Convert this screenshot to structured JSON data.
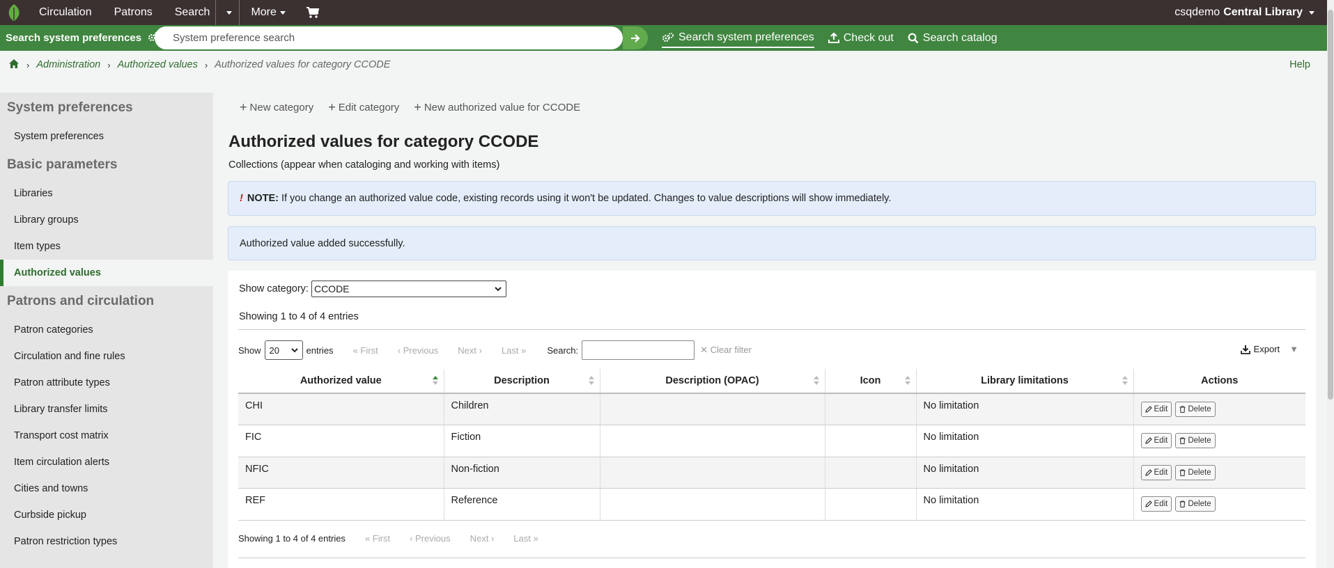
{
  "topnav": {
    "items": [
      "Circulation",
      "Patrons",
      "Search",
      "More"
    ],
    "user": "csqdemo",
    "library": "Central Library"
  },
  "searchbar": {
    "label": "Search system preferences",
    "placeholder": "System preference search",
    "links": [
      "Search system preferences",
      "Check out",
      "Search catalog"
    ]
  },
  "breadcrumb": {
    "home": "home-icon",
    "items": [
      "Administration",
      "Authorized values"
    ],
    "current": "Authorized values for category CCODE",
    "help": "Help"
  },
  "sidebar": {
    "sections": [
      {
        "title": "System preferences",
        "items": [
          "System preferences"
        ]
      },
      {
        "title": "Basic parameters",
        "items": [
          "Libraries",
          "Library groups",
          "Item types",
          "Authorized values"
        ]
      },
      {
        "title": "Patrons and circulation",
        "items": [
          "Patron categories",
          "Circulation and fine rules",
          "Patron attribute types",
          "Library transfer limits",
          "Transport cost matrix",
          "Item circulation alerts",
          "Cities and towns",
          "Curbside pickup",
          "Patron restriction types"
        ]
      }
    ],
    "active": "Authorized values"
  },
  "toolbar": {
    "new_category": "New category",
    "edit_category": "Edit category",
    "new_value": "New authorized value for CCODE"
  },
  "page": {
    "title": "Authorized values for category CCODE",
    "subtitle": "Collections (appear when cataloging and working with items)"
  },
  "alerts": {
    "note_bang": "!",
    "note_label": "NOTE:",
    "note_text": "If you change an authorized value code, existing records using it won't be updated. Changes to value descriptions will show immediately.",
    "success": "Authorized value added successfully."
  },
  "filter": {
    "show_category_label": "Show category:",
    "category": "CCODE",
    "showing_top": "Showing 1 to 4 of 4 entries",
    "show_label": "Show",
    "page_length": "20",
    "entries_label": "entries",
    "first": "First",
    "previous": "Previous",
    "next": "Next",
    "last": "Last",
    "search_label": "Search:",
    "clear_filter": "Clear filter",
    "export": "Export",
    "showing_bottom": "Showing 1 to 4 of 4 entries"
  },
  "table": {
    "columns": [
      "Authorized value",
      "Description",
      "Description (OPAC)",
      "Icon",
      "Library limitations",
      "Actions"
    ],
    "rows": [
      {
        "value": "CHI",
        "description": "Children",
        "opac": "",
        "icon": "",
        "limitations": "No limitation"
      },
      {
        "value": "FIC",
        "description": "Fiction",
        "opac": "",
        "icon": "",
        "limitations": "No limitation"
      },
      {
        "value": "NFIC",
        "description": "Non-fiction",
        "opac": "",
        "icon": "",
        "limitations": "No limitation"
      },
      {
        "value": "REF",
        "description": "Reference",
        "opac": "",
        "icon": "",
        "limitations": "No limitation"
      }
    ],
    "edit_label": "Edit",
    "delete_label": "Delete"
  },
  "colors": {
    "topnav": "#3b3131",
    "searchbar": "#408540",
    "accent": "#2f6d2f",
    "alert_bg": "#e4edf9"
  }
}
